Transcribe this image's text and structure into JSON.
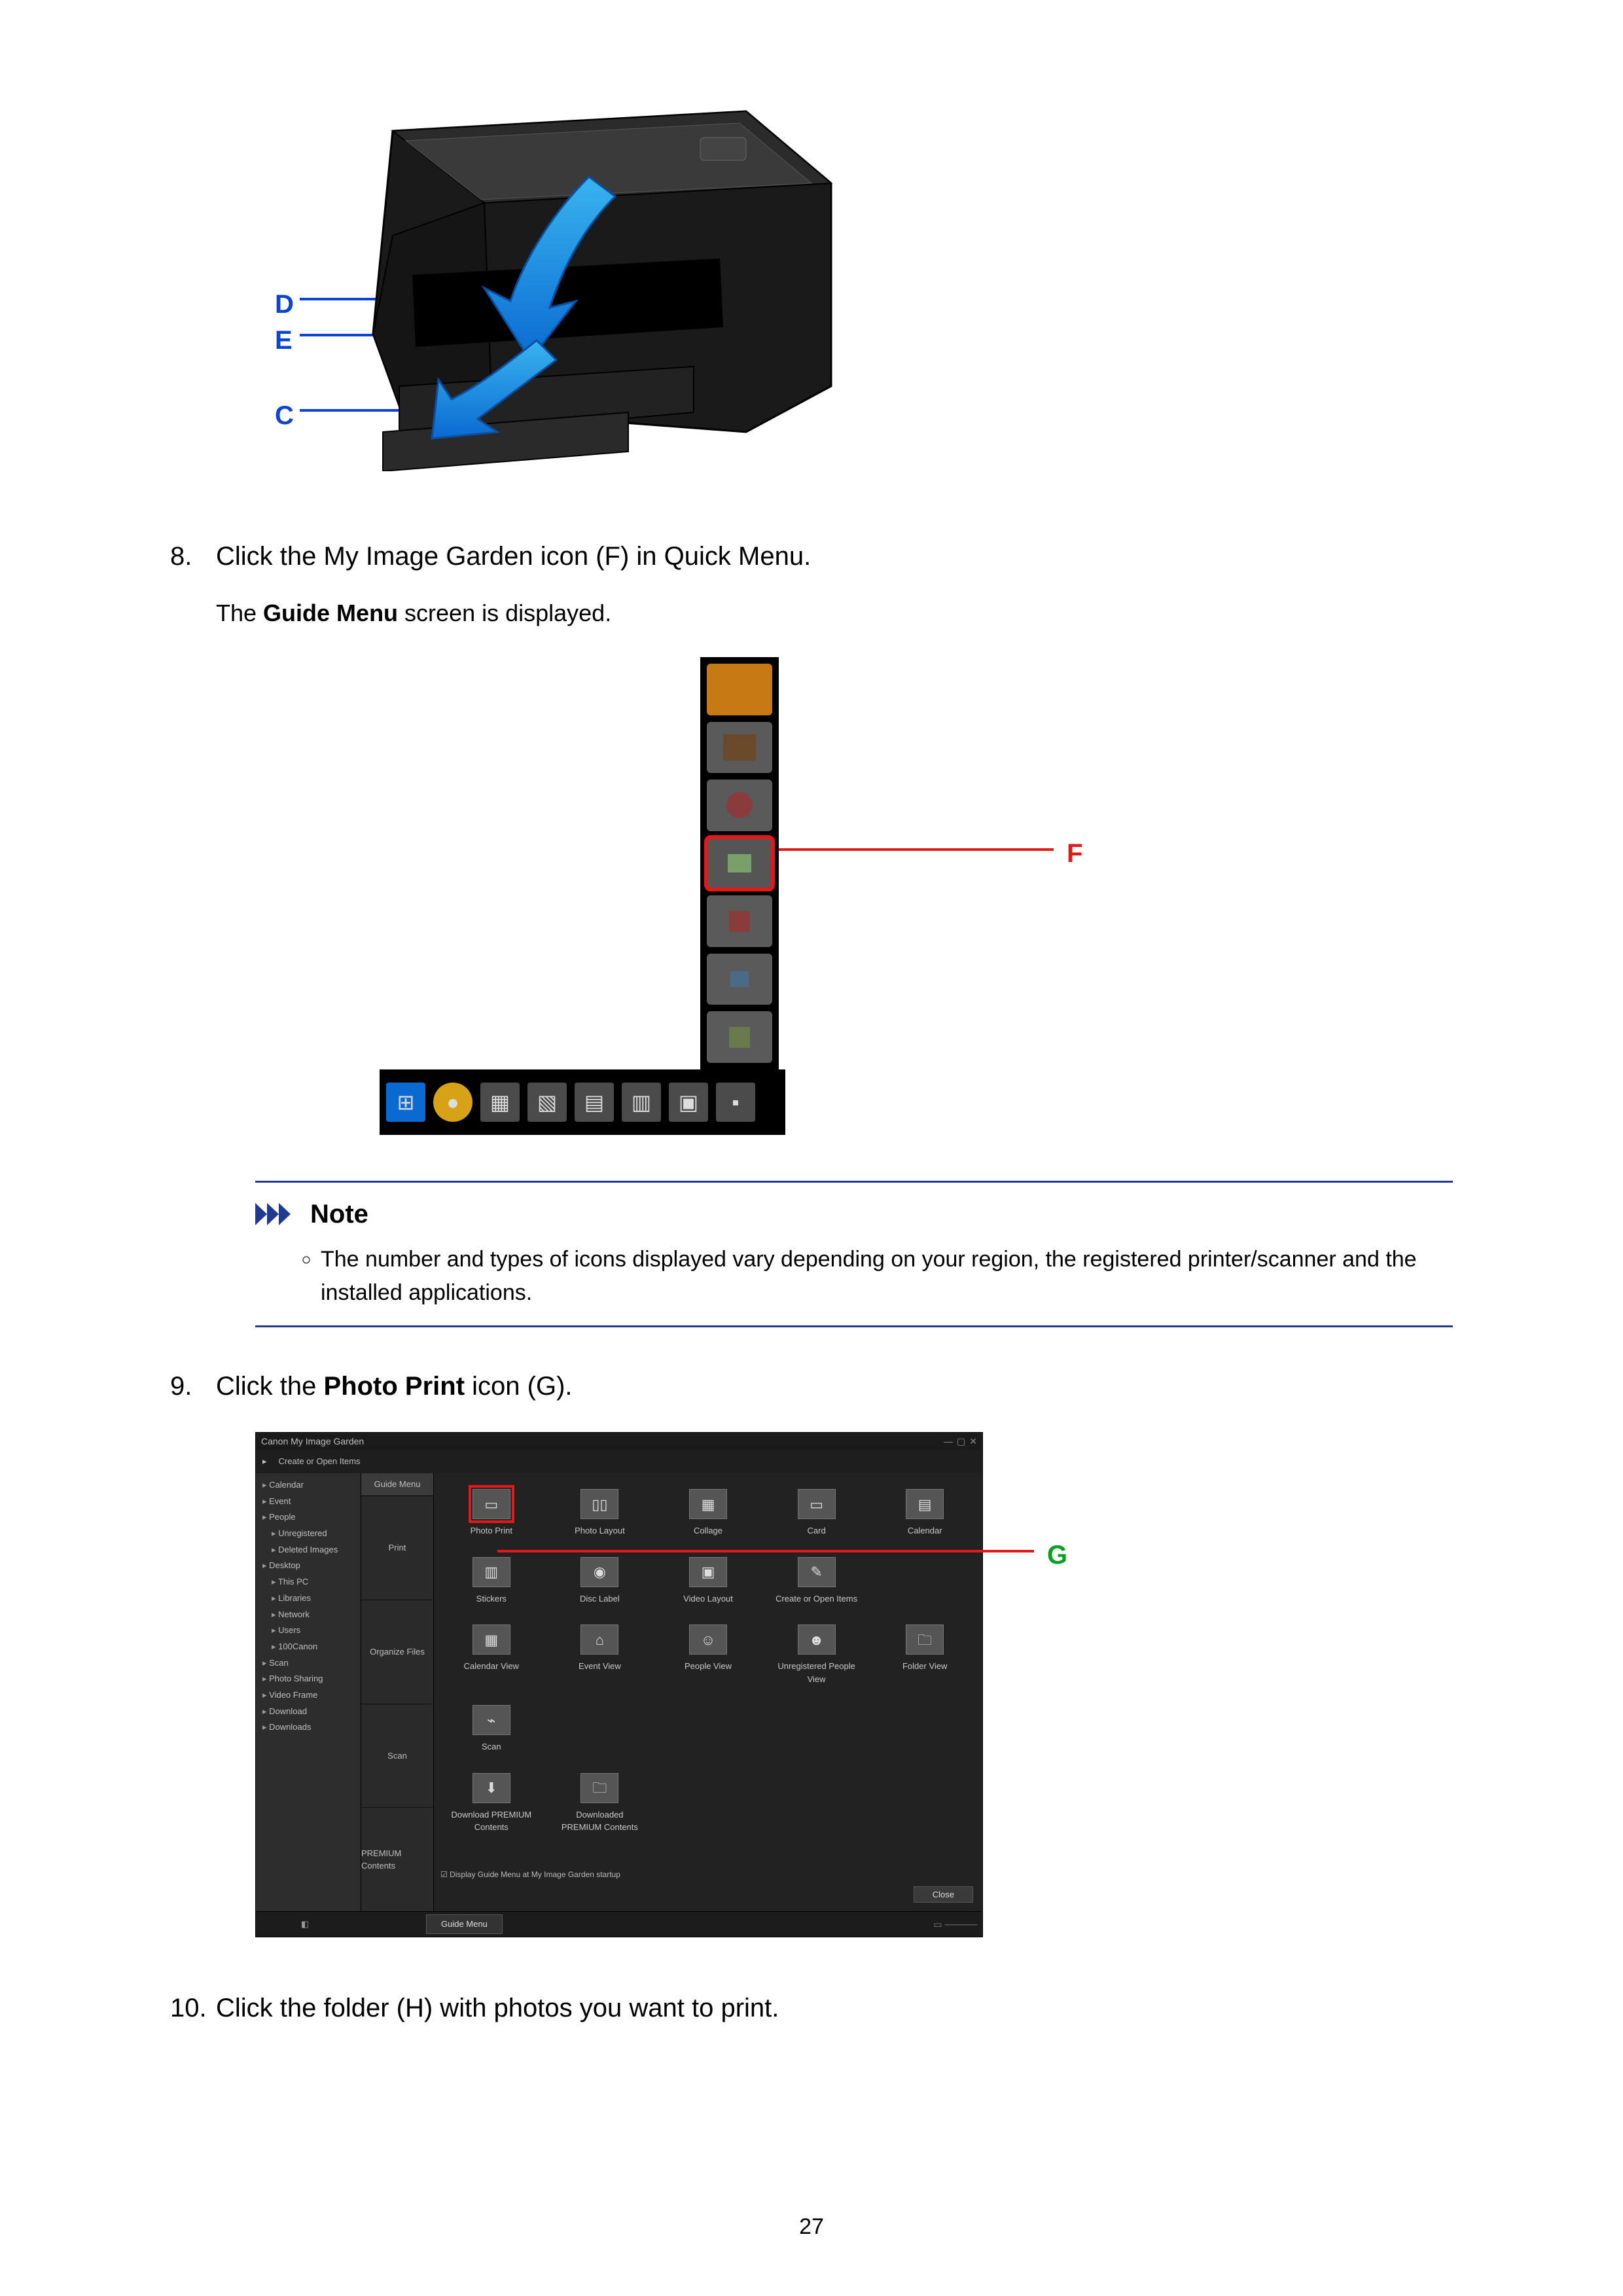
{
  "page_number": "27",
  "steps": {
    "s8": {
      "num": "8.",
      "text_a": "Click the My Image Garden icon (F) in Quick Menu.",
      "detail_a": "The ",
      "detail_b_bold": "Guide Menu",
      "detail_c": " screen is displayed."
    },
    "s9": {
      "num": "9.",
      "text_a": "Click the ",
      "text_b_bold": "Photo Print",
      "text_c": " icon (G)."
    },
    "s10": {
      "num": "10.",
      "text_a": "Click the folder (H) with photos you want to print."
    }
  },
  "printer_labels": {
    "D": "D",
    "E": "E",
    "C": "C"
  },
  "quickmenu": {
    "F_label": "F",
    "taskbar_icons": [
      "start",
      "net",
      "app1",
      "app2",
      "app3",
      "app4",
      "app5",
      "app6"
    ]
  },
  "note": {
    "heading": "Note",
    "items": [
      "The number and types of icons displayed vary depending on your region, the registered printer/scanner and the installed applications."
    ]
  },
  "garden": {
    "title": "Canon My Image Garden",
    "topmenu": "Create or Open Items",
    "sidebar": [
      "Calendar",
      "Event",
      "People",
      "Unregistered",
      "Deleted Images",
      "Desktop",
      "This PC",
      "Libraries",
      "Network",
      "Users",
      "100Canon",
      "Scan",
      "Photo Sharing",
      "Video Frame",
      "Download",
      "Downloads"
    ],
    "panel_tabs": {
      "top": "Guide Menu",
      "p1": "Print",
      "p2": "Organize Files",
      "p3": "Scan",
      "p4": "PREMIUM Contents"
    },
    "grid": {
      "row1": [
        "Photo Print",
        "Photo Layout",
        "Collage",
        "Card",
        "Calendar"
      ],
      "row2": [
        "Stickers",
        "Disc Label",
        "Video Layout",
        "Create or Open Items",
        ""
      ],
      "row3": [
        "Calendar View",
        "Event View",
        "People View",
        "Unregistered People View",
        "Folder View"
      ],
      "row4": [
        "Scan",
        "",
        "",
        "",
        ""
      ],
      "row5": [
        "Download PREMIUM Contents",
        "Downloaded PREMIUM Contents",
        "",
        "",
        ""
      ]
    },
    "footer_check": "Display Guide Menu at My Image Garden startup",
    "close": "Close",
    "status_tab": "Guide Menu",
    "G_label": "G"
  }
}
